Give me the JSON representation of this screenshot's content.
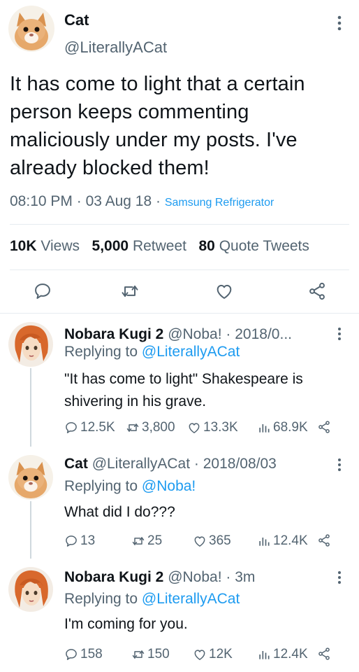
{
  "main_tweet": {
    "author_name": "Cat",
    "author_handle": "@LiterallyACat",
    "text": "It has come to light that a certain person keeps commenting maliciously under my posts. I've already blocked them!",
    "time": "08:10 PM",
    "date": "03 Aug 18",
    "source": "Samsung Refrigerator",
    "stats": {
      "views_count": "10K",
      "views_label": "Views",
      "retweets_count": "5,000",
      "retweets_label": "Retweet",
      "quotes_count": "80",
      "quotes_label": "Quote Tweets"
    }
  },
  "replies": [
    {
      "name": "Nobara Kugi 2",
      "handle": "@Noba!",
      "time": "2018/0...",
      "replying_prefix": "Replying to",
      "replying_to": "@LiterallyACat",
      "text": "\"It has come to light\" Shakespeare is shivering in his grave.",
      "replies": "12.5K",
      "retweets": "3,800",
      "likes": "13.3K",
      "views": "68.9K"
    },
    {
      "name": "Cat",
      "handle": "@LiterallyACat",
      "time": "2018/08/03",
      "replying_prefix": "Replying to",
      "replying_to": "@Noba!",
      "text": "What did I do???",
      "replies": "13",
      "retweets": "25",
      "likes": "365",
      "views": "12.4K"
    },
    {
      "name": "Nobara Kugi 2",
      "handle": "@Noba!",
      "time": "3m",
      "replying_prefix": "Replying to",
      "replying_to": "@LiterallyACat",
      "text": "I'm coming for you.",
      "replies": "158",
      "retweets": "150",
      "likes": "12K",
      "views": "12.4K"
    }
  ],
  "colors": {
    "accent": "#1d9bf0",
    "secondary_text": "#536471",
    "text": "#0f1419",
    "divider": "#e6ecf0"
  },
  "icons": [
    "more-vertical-icon",
    "reply-icon",
    "retweet-icon",
    "like-icon",
    "share-icon",
    "views-icon"
  ]
}
